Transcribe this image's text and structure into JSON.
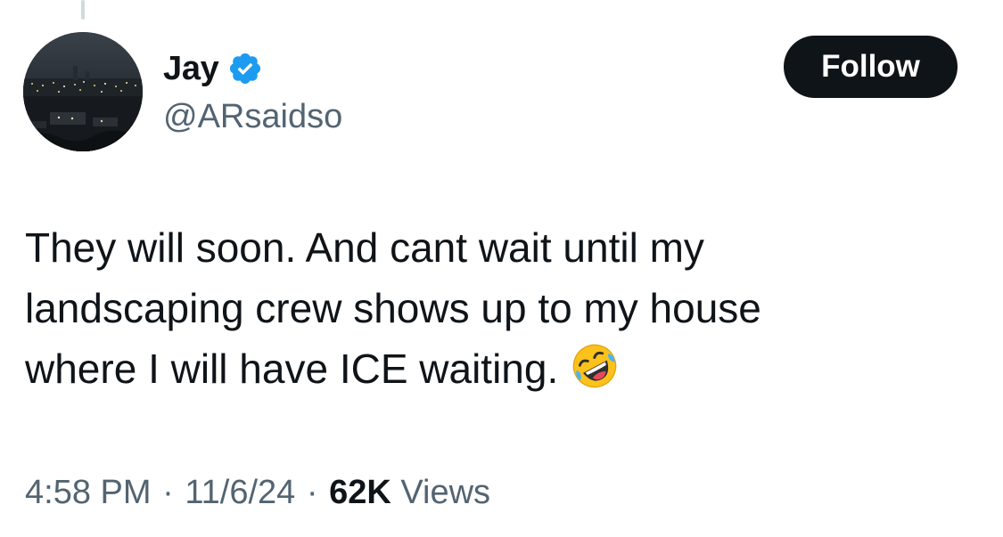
{
  "author": {
    "display_name": "Jay",
    "handle": "@ARsaidso",
    "verified": true,
    "verified_icon": "verified-badge-icon",
    "avatar_icon": "city-night-skyline-avatar"
  },
  "follow_button": {
    "label": "Follow"
  },
  "tweet": {
    "lines": [
      "They will soon. And cant wait until my",
      "landscaping crew shows up to my house",
      "where I will have ICE waiting."
    ],
    "emoji": "rolling-on-floor-laughing-emoji"
  },
  "meta": {
    "time": "4:58 PM",
    "separator": "·",
    "date": "11/6/24",
    "views_count": "62K",
    "views_label": "Views"
  },
  "colors": {
    "text_primary": "#0f1419",
    "text_secondary": "#536471",
    "verified_blue": "#1d9bf0",
    "button_bg": "#0f1419",
    "button_text": "#ffffff",
    "thread_line": "#cfd9de"
  }
}
